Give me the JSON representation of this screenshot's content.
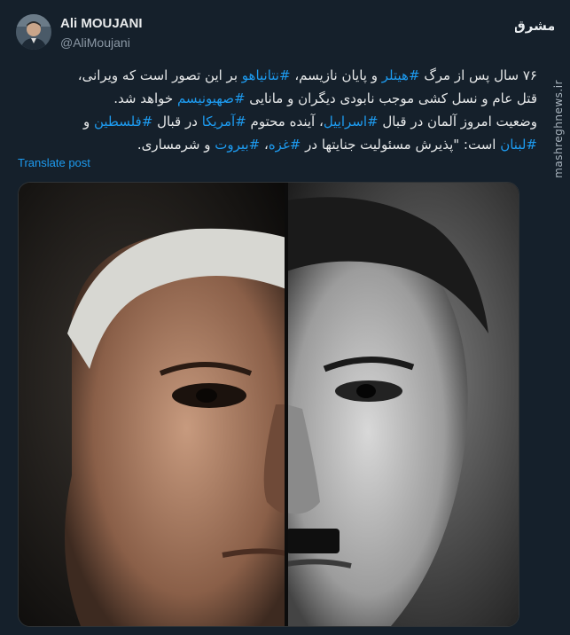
{
  "author": {
    "display_name": "Ali MOUJANI",
    "handle": "@AliMoujani"
  },
  "brand": {
    "logo_text": "مشرق",
    "watermark": "mashreghnews.ir"
  },
  "tweet": {
    "line1_a": "۷۶ سال پس از مرگ ",
    "tag_hitler": "#هیتلر",
    "line1_b": " و پایان نازیسم، ",
    "tag_netanyahu": "#نتانیاهو",
    "line1_c": " بر این تصور است که ویرانی،",
    "line2_a": "قتل عام و نسل کشی موجب نابودی دیگران و مانایی ",
    "tag_zionism": "#صهیونیسم",
    "line2_b": " خواهد شد.",
    "line3_a": "وضعیت امروز آلمان در قبال ",
    "tag_israel": "#اسراییل",
    "line3_b": "، آینده محتوم ",
    "tag_america": "#آمریکا",
    "line3_c": " در قبال ",
    "tag_palestine": "#فلسطین",
    "line3_d": " و",
    "tag_lebanon": "#لبنان",
    "line4_a": " است: \"پذیرش مسئولیت جنایتها در ",
    "tag_gaza": "#غزه",
    "line4_b": "، ",
    "tag_beirut": "#بیروت",
    "line4_c": " و شرمساری."
  },
  "translate_label": "Translate post",
  "colors": {
    "background": "#15202b",
    "link": "#1d9bf0",
    "text": "#e7e9ea",
    "muted": "#8b98a5"
  }
}
